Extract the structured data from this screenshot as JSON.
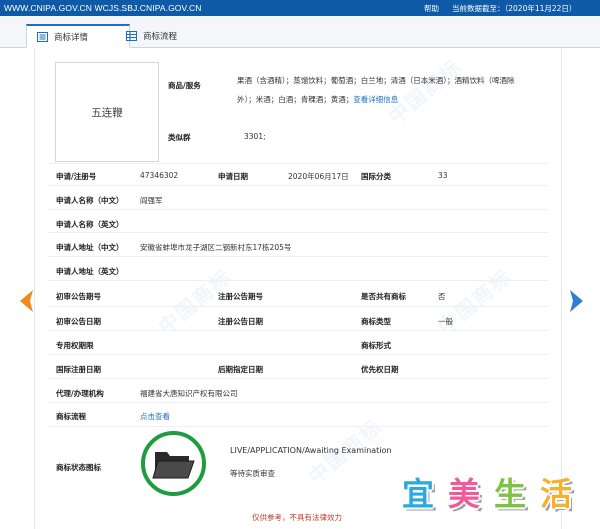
{
  "topbar": {
    "urls": "WWW.CNIPA.GOV.CN WCJS.SBJ.CNIPA.GOV.CN",
    "help": "帮助",
    "data_cutoff": "当前数据截至：（2020年11月22日）"
  },
  "tabs": {
    "details": "商标详情",
    "flow": "商标流程"
  },
  "mark_text": "五连鞭",
  "goods_label": "商品/服务",
  "goods_text": "果酒（含酒精）；蒸馏饮料；葡萄酒；白兰地；清酒（日本米酒）；酒精饮料（啤酒除外）；米酒；白酒；青稞酒；黄酒；",
  "goods_more": "查看详细信息",
  "similar_group_label": "类似群",
  "similar_group_value": "3301;",
  "fields": {
    "reg_no_label": "申请/注册号",
    "reg_no_value": "47346302",
    "app_date_label": "申请日期",
    "app_date_value": "2020年06月17日",
    "intl_class_label": "国际分类",
    "intl_class_value": "33",
    "applicant_cn_label": "申请人名称（中文）",
    "applicant_cn_value": "阎强军",
    "applicant_en_label": "申请人名称（英文）",
    "address_cn_label": "申请人地址（中文）",
    "address_cn_value": "安徽省蚌埠市龙子湖区二钢新村东17栋205号",
    "address_en_label": "申请人地址（英文）",
    "prelim_no_label": "初审公告期号",
    "reg_notice_no_label": "注册公告期号",
    "shared_label": "是否共有商标",
    "shared_value": "否",
    "prelim_date_label": "初审公告日期",
    "reg_notice_date_label": "注册公告日期",
    "mark_type_label": "商标类型",
    "mark_type_value": "一般",
    "exclusive_period_label": "专用权期限",
    "mark_form_label": "商标形式",
    "intl_reg_date_label": "国际注册日期",
    "later_designation_label": "后期指定日期",
    "priority_date_label": "优先权日期",
    "agent_label": "代理/办理机构",
    "agent_value": "福建省大唐知识产权有限公司",
    "flow_label": "商标流程",
    "flow_link": "点击查看",
    "status_icon_label": "商标状态图标"
  },
  "status": {
    "english": "LIVE/APPLICATION/Awaiting Examination",
    "chinese": "等待实质审查"
  },
  "disclaimer": "仅供参考，不具有法律效力",
  "watermark_brand": [
    "宜",
    "美",
    "生",
    "活"
  ],
  "colors": {
    "topbar": "#0e5aa7",
    "arrow_left": "#f08a1c",
    "arrow_right": "#2f7fd0",
    "status_ring": "#1f9c3f",
    "disclaimer": "#c0392b"
  }
}
